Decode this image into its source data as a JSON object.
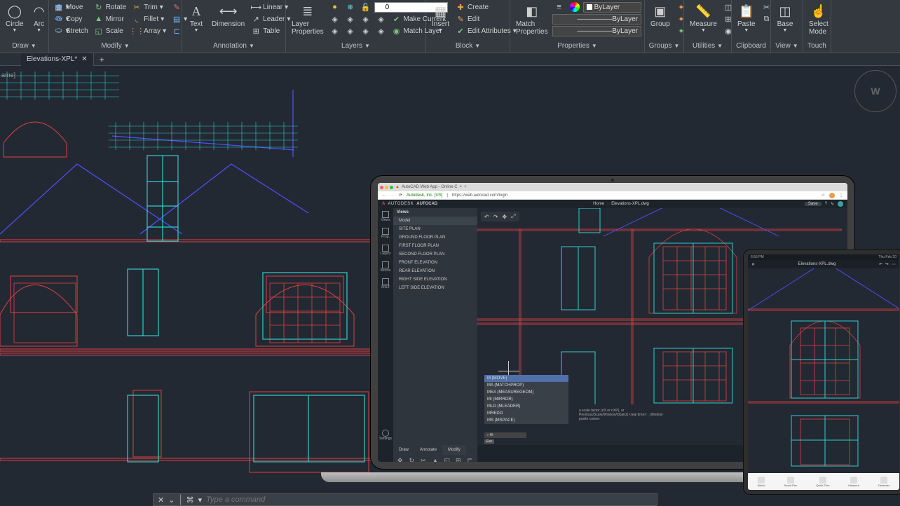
{
  "ribbon": {
    "draw": {
      "circle": "Circle",
      "arc": "Arc",
      "label": "Draw"
    },
    "modify": {
      "move": "Move",
      "copy": "Copy",
      "stretch": "Stretch",
      "rotate": "Rotate",
      "mirror": "Mirror",
      "scale": "Scale",
      "trim": "Trim",
      "fillet": "Fillet",
      "array": "Array",
      "label": "Modify"
    },
    "annotation": {
      "text": "Text",
      "dimension": "Dimension",
      "linear": "Linear",
      "leader": "Leader",
      "table": "Table",
      "label": "Annotation"
    },
    "layers": {
      "layer_properties": "Layer\nProperties",
      "value": "0",
      "make_current": "Make Current",
      "match_layer": "Match Layer",
      "label": "Layers"
    },
    "block": {
      "insert": "Insert",
      "create": "Create",
      "edit": "Edit",
      "edit_attributes": "Edit Attributes",
      "label": "Block"
    },
    "properties": {
      "match": "Match\nProperties",
      "bylayer": "ByLayer",
      "label": "Properties"
    },
    "groups": {
      "group": "Group",
      "label": "Groups"
    },
    "utilities": {
      "measure": "Measure",
      "label": "Utilities"
    },
    "clipboard": {
      "paste": "Paste",
      "label": "Clipboard"
    },
    "view": {
      "base": "Base",
      "label": "View"
    },
    "touch": {
      "select_mode": "Select\nMode",
      "label": "Touch"
    }
  },
  "tab": {
    "name": "Elevations-XPL*"
  },
  "viewcube": {
    "face": "W"
  },
  "webapp": {
    "browser_tab": "AutoCAD Web App - Online C",
    "addr_host": "Autodesk, Inc. [US]",
    "addr_url": "https://web.autocad.com/login",
    "brand1": "AUTODESK",
    "brand2": "AUTOCAD",
    "breadcrumb": [
      "Home",
      "Elevations-XPL.dwg"
    ],
    "save": "Save",
    "leftnav": [
      "Views",
      "Prop.",
      "Layers",
      "Blocks",
      "XREF",
      "Settings"
    ],
    "views_title": "Views",
    "views": [
      "Model",
      "SITE PLAN",
      "GROUND FLOOR PLAN",
      "FIRST FLOOR PLAN",
      "SECOND FLOOR PLAN",
      "FRONT  ELEVATION",
      "REAR  ELEVATION",
      "RIGHT SIDE ELEVATION",
      "LEFT SIDE  ELEVATION"
    ],
    "autocomplete": [
      "M (MOVE)",
      "MA (MATCHPROP)",
      "MEA (MEASUREGEOM)",
      "MI (MIRROR)",
      "MLD (MLEADER)",
      "MREDO",
      "MS (MSPACE)"
    ],
    "cmd_prompt1": "a scale factor (nX or nXP), or",
    "cmd_prompt2": "Previous/Scale/Window/Object] <real time>: _Window",
    "cmd_prompt3": "posite corner:",
    "cmd_input": "m",
    "esc": "Esc",
    "tabs": [
      "Draw",
      "Annotate",
      "Modify"
    ]
  },
  "tablet": {
    "time": "6:56 PM",
    "date": "Thu Feb 20",
    "file": "Elevations-XPL.dwg",
    "tools": [
      "Select",
      "Smart Pen",
      "Quick Trim",
      "Measure",
      "Dimensio"
    ]
  },
  "commandline": {
    "placeholder": "Type a command"
  }
}
